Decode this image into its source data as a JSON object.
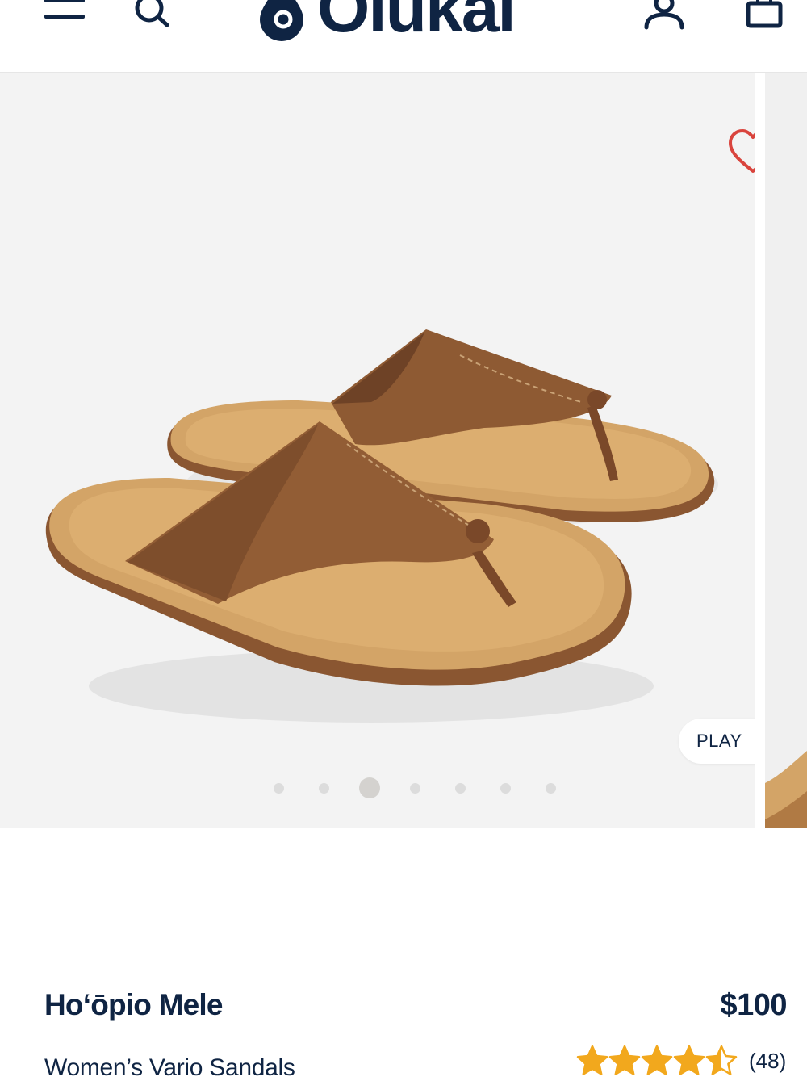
{
  "brand": {
    "name": "OluKai",
    "logo_text": "Olukai"
  },
  "header": {
    "menu_icon": "hamburger-menu-icon",
    "search_icon": "search-icon",
    "account_icon": "user-account-icon",
    "cart_icon": "shopping-bag-icon"
  },
  "gallery": {
    "play_label": "PLAY",
    "slide_count": 7,
    "active_slide_index": 2,
    "wishlist_icon": "heart-outline-icon"
  },
  "product": {
    "name": "Hoʻōpio Mele",
    "price": "$100",
    "subtitle": "Women’s Vario Sandals",
    "rating": 4.5,
    "rating_max": 5,
    "review_count": "(48)"
  },
  "colors": {
    "brand_navy": "#0f2443",
    "star_gold": "#f2a81d",
    "heart_red": "#d9443d",
    "gallery_bg": "#f3f3f3"
  }
}
